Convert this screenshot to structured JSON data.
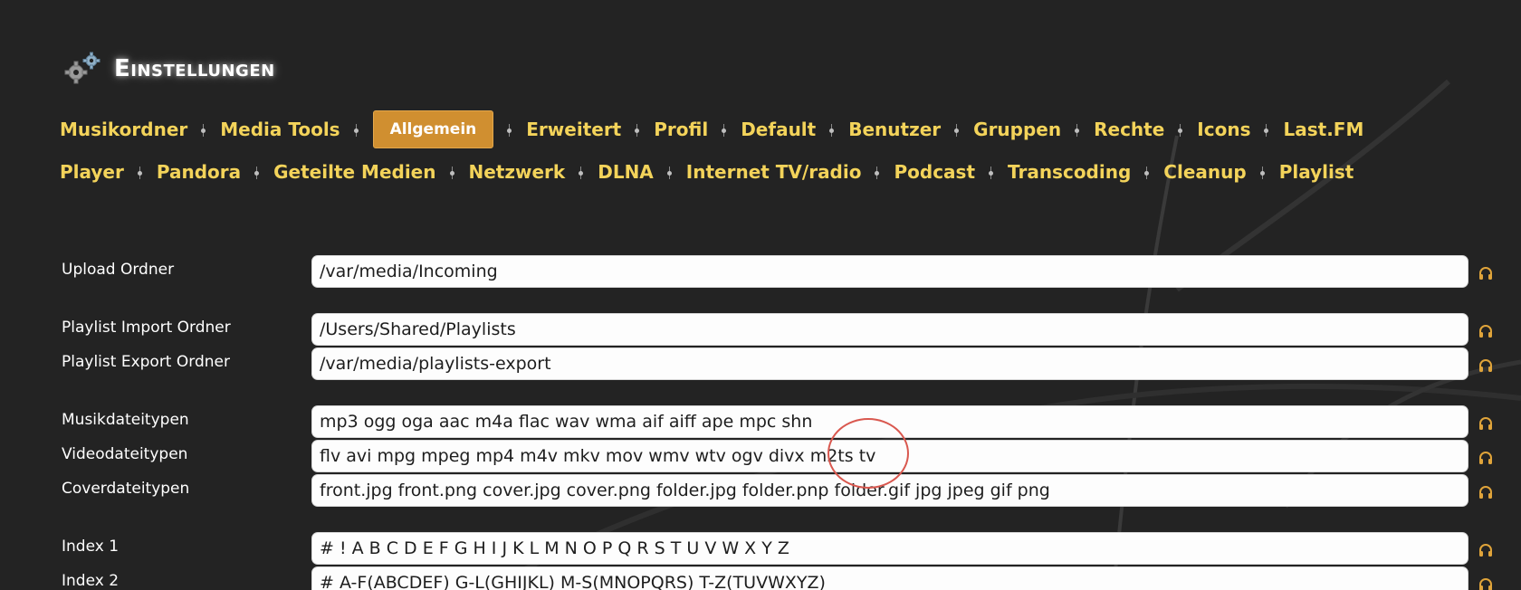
{
  "page": {
    "title": "Einstellungen"
  },
  "tabs": {
    "row1": [
      {
        "label": "Musikordner"
      },
      {
        "label": "Media Tools"
      },
      {
        "label": "Allgemein",
        "active": true
      },
      {
        "label": "Erweitert"
      },
      {
        "label": "Profil"
      },
      {
        "label": "Default"
      },
      {
        "label": "Benutzer"
      },
      {
        "label": "Gruppen"
      },
      {
        "label": "Rechte"
      },
      {
        "label": "Icons"
      },
      {
        "label": "Last.FM"
      }
    ],
    "row2": [
      {
        "label": "Player"
      },
      {
        "label": "Pandora"
      },
      {
        "label": "Geteilte Medien"
      },
      {
        "label": "Netzwerk"
      },
      {
        "label": "DLNA"
      },
      {
        "label": "Internet TV/radio"
      },
      {
        "label": "Podcast"
      },
      {
        "label": "Transcoding"
      },
      {
        "label": "Cleanup"
      },
      {
        "label": "Playlist"
      }
    ]
  },
  "settings": [
    {
      "label": "Upload Ordner",
      "value": "/var/media/Incoming"
    },
    {
      "label": "Playlist Import Ordner",
      "value": "/Users/Shared/Playlists"
    },
    {
      "label": "Playlist Export Ordner",
      "value": "/var/media/playlists-export"
    },
    {
      "label": "Musikdateitypen",
      "value": "mp3 ogg oga aac m4a flac wav wma aif aiff ape mpc shn"
    },
    {
      "label": "Videodateitypen",
      "value": "flv avi mpg mpeg mp4 m4v mkv mov wmv wtv ogv divx m2ts tv"
    },
    {
      "label": "Coverdateitypen",
      "value": "front.jpg front.png cover.jpg cover.png folder.jpg folder.pnp folder.gif jpg jpeg gif png"
    },
    {
      "label": "Index 1",
      "value": "# ! A B C D E F G H I J K L M N O P Q R S T U V W X Y Z"
    },
    {
      "label": "Index 2",
      "value": "# A-F(ABCDEF) G-L(GHIJKL) M-S(MNOPQRS) T-Z(TUVWXYZ)"
    }
  ],
  "icons": {
    "header": "gears-icon",
    "field_action": "headphones-icon"
  },
  "colors": {
    "background": "#232323",
    "tab_text": "#f3d35a",
    "tab_active_bg": "#d08f30",
    "icon_accent": "#e0a43a",
    "annotation_circle": "#d9584f"
  }
}
